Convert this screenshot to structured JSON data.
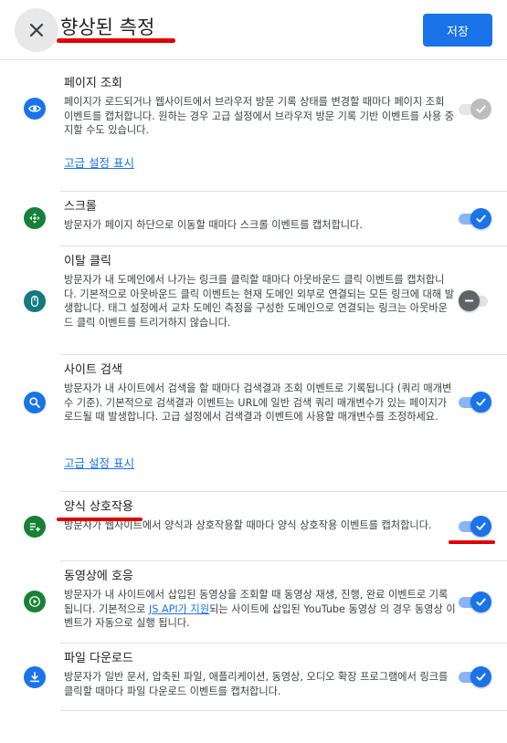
{
  "header": {
    "title": "향상된 측정",
    "save_label": "저장",
    "close_icon": "close-icon"
  },
  "colors": {
    "accent": "#1a73e8",
    "annotation": "#e00000",
    "icon_blue": "#1a73e8",
    "icon_green": "#188038",
    "icon_teal": "#137a7f"
  },
  "sections": [
    {
      "id": "page-view",
      "title": "페이지 조회",
      "icon": "eye-icon",
      "description": "페이지가 로드되거나 웹사이트에서 브라우저 방문 기록 상태를 변경할 때마다 페이지 조회 이벤트를 캡처합니다. 원하는 경우 고급 설정에서 브라우저 방문 기록 기반 이벤트를 사용 중지할 수도 있습니다.",
      "advanced_link": "고급 설정 표시",
      "toggle_state": "disabled-on"
    },
    {
      "id": "scroll",
      "title": "스크롤",
      "icon": "scroll-icon",
      "description": "방문자가 페이지 하단으로 이동할 때마다 스크롤 이벤트를 캡처합니다.",
      "toggle_state": "on"
    },
    {
      "id": "outbound-click",
      "title": "이탈 클릭",
      "icon": "mouse-icon",
      "description": "방문자가 내 도메인에서 나가는 링크를 클릭할 때마다 아웃바운드 클릭 이벤트를 캡처합니다. 기본적으로 아웃바운드 클릭 이벤트는 현재 도메인 외부로 연결되는 모든 링크에 대해 발생합니다. 태그 설정에서 교차 도메인 측정을 구성한 도메인으로 연결되는 링크는 아웃바운드 클릭 이벤트를 트리거하지 않습니다.",
      "toggle_state": "off"
    },
    {
      "id": "site-search",
      "title": "사이트 검색",
      "icon": "search-icon",
      "description": "방문자가 내 사이트에서 검색을 할 때마다 검색결과 조회 이벤트로 기록됩니다 (쿼리 매개변수 기준). 기본적으로 검색결과 이벤트는 URL에 일반 검색 쿼리 매개변수가 있는 페이지가 로드될 때 발생합니다. 고급 설정에서 검색결과 이벤트에 사용할 매개변수를 조정하세요.",
      "advanced_link": "고급 설정 표시",
      "toggle_state": "on"
    },
    {
      "id": "form-interaction",
      "title": "양식 상호작용",
      "icon": "form-icon",
      "description": "방문자가 웹사이트에서 양식과 상호작용할 때마다 양식 상호작용 이벤트를 캡처합니다.",
      "toggle_state": "on"
    },
    {
      "id": "video-engagement",
      "title": "동영상에 호응",
      "icon": "play-icon",
      "description_before": "방문자가 내 사이트에서 삽입된 동영상을 조회할 때 동영상 재생, 진행, 완료 이벤트로 기록 됩니다. 기본적으로 ",
      "description_link": "JS API가 지원",
      "description_after": "되는 사이트에 삽입된 YouTube 동영상 의 경우 동영상 이벤트가 자동으로 실행 됩니다.",
      "toggle_state": "on"
    },
    {
      "id": "file-download",
      "title": "파일 다운로드",
      "icon": "download-icon",
      "description": "방문자가 일반 문서, 압축된 파일, 애플리케이션, 동영상, 오디오 확장 프로그램에서 링크를 클릭할 때마다 파일 다운로드 이벤트를 캡처합니다.",
      "toggle_state": "on"
    }
  ]
}
